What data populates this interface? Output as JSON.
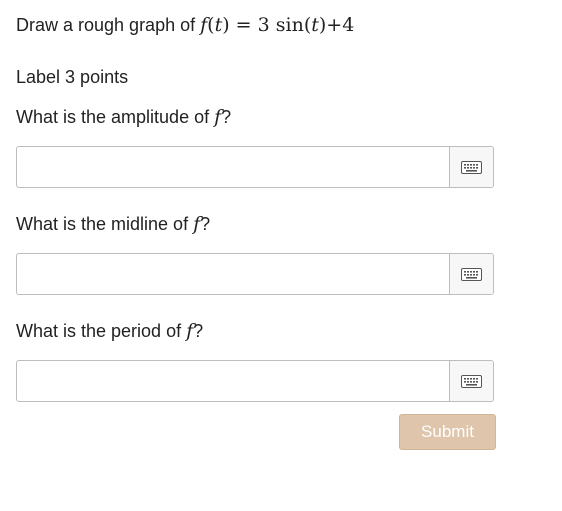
{
  "prompt": {
    "lead": "Draw a rough graph of ",
    "func": "f",
    "open_paren": "(",
    "var": "t",
    "close_paren_eq": ") = 3 sin(",
    "var2": "t",
    "tail": ")+4"
  },
  "label_points": "Label 3 points",
  "questions": [
    {
      "prefix": "What is the amplitude of ",
      "fvar": "f",
      "suffix": "?",
      "value": "",
      "placeholder": ""
    },
    {
      "prefix": "What is the midline of ",
      "fvar": "f",
      "suffix": "?",
      "value": "",
      "placeholder": ""
    },
    {
      "prefix": "What is the period of ",
      "fvar": "f",
      "suffix": "?",
      "value": "",
      "placeholder": ""
    }
  ],
  "icons": {
    "keyboard": "keyboard-icon"
  },
  "submit_label": "Submit",
  "colors": {
    "submit_bg": "#dfc5ab",
    "border": "#bdbdbd"
  }
}
